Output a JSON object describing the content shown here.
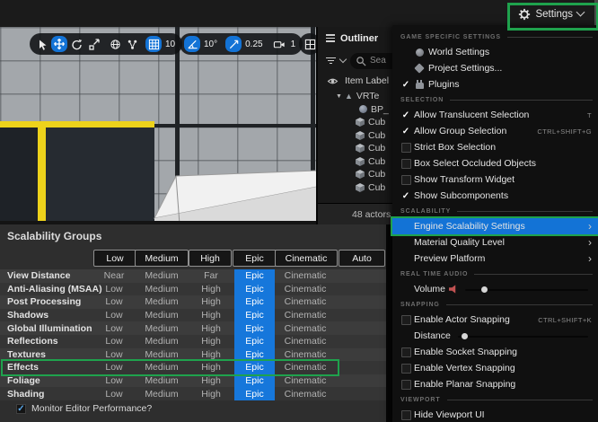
{
  "colors": {
    "accent_blue": "#1373d6",
    "epic_blue": "#1677db",
    "annotation_green": "#1fa24d",
    "selection_yellow": "#edd21b"
  },
  "topbar": {
    "settings_label": "Settings"
  },
  "viewport_toolbar": {
    "grid_snap": "10",
    "angle_snap": "10°",
    "scale_snap": "0.25",
    "camera_speed": "1"
  },
  "outliner": {
    "title": "Outliner",
    "search_placeholder": "Sea",
    "column_header": "Item Label",
    "footer": "48 actors",
    "tree": [
      {
        "label": "VRTe",
        "icon": "world",
        "arrow": true,
        "indent": 20
      },
      {
        "label": "BP_",
        "icon": "sphere",
        "indent": 46
      },
      {
        "label": "Cub",
        "icon": "cube",
        "indent": 42
      },
      {
        "label": "Cub",
        "icon": "cube",
        "indent": 42
      },
      {
        "label": "Cub",
        "icon": "cube",
        "indent": 42
      },
      {
        "label": "Cub",
        "icon": "cube",
        "indent": 42
      },
      {
        "label": "Cub",
        "icon": "cube",
        "indent": 42
      },
      {
        "label": "Cub",
        "icon": "cube",
        "indent": 42
      }
    ]
  },
  "scalability": {
    "title": "Scalability Groups",
    "header_buttons": [
      "Low",
      "Medium",
      "High",
      "Epic",
      "Cinematic",
      "Auto"
    ],
    "rows": [
      {
        "label": "View Distance",
        "values": [
          "Near",
          "Medium",
          "Far",
          "Epic",
          "Cinematic"
        ],
        "selected": 3
      },
      {
        "label": "Anti-Aliasing (MSAA)",
        "values": [
          "Low",
          "Medium",
          "High",
          "Epic",
          "Cinematic"
        ],
        "selected": 3
      },
      {
        "label": "Post Processing",
        "values": [
          "Low",
          "Medium",
          "High",
          "Epic",
          "Cinematic"
        ],
        "selected": 3
      },
      {
        "label": "Shadows",
        "values": [
          "Low",
          "Medium",
          "High",
          "Epic",
          "Cinematic"
        ],
        "selected": 3
      },
      {
        "label": "Global Illumination",
        "values": [
          "Low",
          "Medium",
          "High",
          "Epic",
          "Cinematic"
        ],
        "selected": 3
      },
      {
        "label": "Reflections",
        "values": [
          "Low",
          "Medium",
          "High",
          "Epic",
          "Cinematic"
        ],
        "selected": 3
      },
      {
        "label": "Textures",
        "values": [
          "Low",
          "Medium",
          "High",
          "Epic",
          "Cinematic"
        ],
        "selected": 3
      },
      {
        "label": "Effects",
        "values": [
          "Low",
          "Medium",
          "High",
          "Epic",
          "Cinematic"
        ],
        "selected": 3,
        "highlighted": true
      },
      {
        "label": "Foliage",
        "values": [
          "Low",
          "Medium",
          "High",
          "Epic",
          "Cinematic"
        ],
        "selected": 3
      },
      {
        "label": "Shading",
        "values": [
          "Low",
          "Medium",
          "High",
          "Epic",
          "Cinematic"
        ],
        "selected": 3
      }
    ],
    "monitor_label": "Monitor Editor Performance?",
    "monitor_checked": true
  },
  "menu": {
    "sections": [
      {
        "header": "GAME SPECIFIC SETTINGS",
        "items": [
          {
            "label": "World Settings",
            "icon": "sphere"
          },
          {
            "label": "Project Settings...",
            "icon": "project"
          },
          {
            "label": "Plugins",
            "icon": "plug",
            "checked": true
          }
        ]
      },
      {
        "header": "SELECTION",
        "items": [
          {
            "label": "Allow Translucent Selection",
            "type": "check",
            "checked": true,
            "shortcut": "T"
          },
          {
            "label": "Allow Group Selection",
            "type": "check",
            "checked": true,
            "shortcut": "CTRL+SHIFT+G"
          },
          {
            "label": "Strict Box Selection",
            "type": "check",
            "checked": false
          },
          {
            "label": "Box Select Occluded Objects",
            "type": "check",
            "checked": false
          },
          {
            "label": "Show Transform Widget",
            "type": "check",
            "checked": false
          },
          {
            "label": "Show Subcomponents",
            "type": "check",
            "checked": true
          }
        ]
      },
      {
        "header": "SCALABILITY",
        "items": [
          {
            "label": "Engine Scalability Settings",
            "submenu": true,
            "highlighted": true
          },
          {
            "label": "Material Quality Level",
            "submenu": true
          },
          {
            "label": "Preview Platform",
            "submenu": true
          }
        ]
      },
      {
        "header": "REAL TIME AUDIO",
        "items": [
          {
            "label": "Volume",
            "icon_after": "speaker",
            "slider": 0.15
          }
        ]
      },
      {
        "header": "SNAPPING",
        "items": [
          {
            "label": "Enable Actor Snapping",
            "type": "check",
            "checked": false,
            "shortcut": "CTRL+SHIFT+K"
          },
          {
            "label": "Distance",
            "slider": 0.05
          },
          {
            "label": "Enable Socket Snapping",
            "type": "check",
            "checked": false
          },
          {
            "label": "Enable Vertex Snapping",
            "type": "check",
            "checked": false
          },
          {
            "label": "Enable Planar Snapping",
            "type": "check",
            "checked": false
          }
        ]
      },
      {
        "header": "VIEWPORT",
        "items": [
          {
            "label": "Hide Viewport UI",
            "type": "check",
            "checked": false
          }
        ]
      }
    ]
  }
}
